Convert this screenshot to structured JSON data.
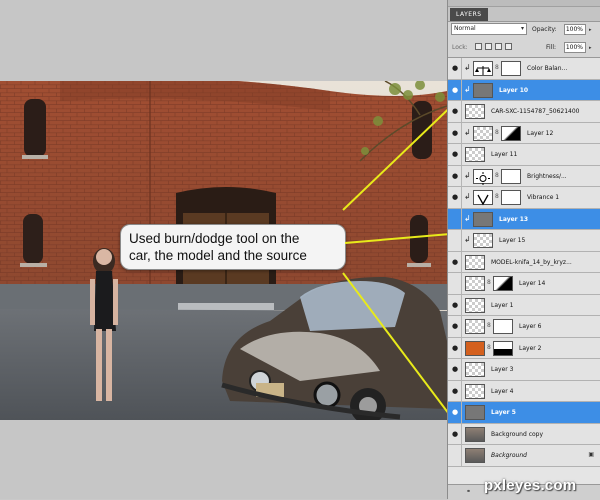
{
  "callout": {
    "line1": "Used burn/dodge tool on the",
    "line2": "car, the model and the source"
  },
  "panel": {
    "tab_label": "LAYERS",
    "blend_mode": "Normal",
    "opacity_label": "Opacity:",
    "opacity_value": "100%",
    "lock_label": "Lock:",
    "fill_label": "Fill:",
    "fill_value": "100%"
  },
  "layers": [
    {
      "name": "Color Balan...",
      "visible": true,
      "clipped": true,
      "selected": false,
      "thumb": "adjust-balance",
      "mask": true
    },
    {
      "name": "Layer 10",
      "visible": true,
      "clipped": true,
      "selected": true,
      "thumb": "gray",
      "mask": false
    },
    {
      "name": "CAR-SXC-1154787_50621400",
      "visible": true,
      "clipped": false,
      "selected": false,
      "thumb": "trans",
      "mask": false
    },
    {
      "name": "Layer 12",
      "visible": true,
      "clipped": true,
      "selected": false,
      "thumb": "trans",
      "mask": true
    },
    {
      "name": "Layer 11",
      "visible": true,
      "clipped": false,
      "selected": false,
      "thumb": "trans",
      "mask": false
    },
    {
      "name": "Brightness/...",
      "visible": true,
      "clipped": true,
      "selected": false,
      "thumb": "adjust-brightness",
      "mask": true
    },
    {
      "name": "Vibrance 1",
      "visible": true,
      "clipped": true,
      "selected": false,
      "thumb": "adjust-vibrance",
      "mask": true
    },
    {
      "name": "Layer 13",
      "visible": false,
      "clipped": true,
      "selected": true,
      "thumb": "gray",
      "mask": false
    },
    {
      "name": "Layer 15",
      "visible": false,
      "clipped": true,
      "selected": false,
      "thumb": "trans",
      "mask": false
    },
    {
      "name": "MODEL-knifa_14_by_kryz...",
      "visible": true,
      "clipped": false,
      "selected": false,
      "thumb": "trans",
      "mask": false
    },
    {
      "name": "Layer 14",
      "visible": false,
      "clipped": false,
      "selected": false,
      "thumb": "trans",
      "mask": true
    },
    {
      "name": "Layer 1",
      "visible": true,
      "clipped": false,
      "selected": false,
      "thumb": "trans",
      "mask": false
    },
    {
      "name": "Layer 6",
      "visible": true,
      "clipped": false,
      "selected": false,
      "thumb": "trans",
      "mask": true
    },
    {
      "name": "Layer 2",
      "visible": true,
      "clipped": false,
      "selected": false,
      "thumb": "orange",
      "mask": true
    },
    {
      "name": "Layer 3",
      "visible": true,
      "clipped": false,
      "selected": false,
      "thumb": "trans",
      "mask": false
    },
    {
      "name": "Layer 4",
      "visible": true,
      "clipped": false,
      "selected": false,
      "thumb": "trans",
      "mask": false
    },
    {
      "name": "Layer 5",
      "visible": true,
      "clipped": false,
      "selected": true,
      "thumb": "gray",
      "mask": false
    },
    {
      "name": "Background copy",
      "visible": true,
      "clipped": false,
      "selected": false,
      "thumb": "photo",
      "mask": false
    },
    {
      "name": "Background",
      "visible": false,
      "clipped": false,
      "selected": false,
      "thumb": "photo",
      "mask": false,
      "italic": true,
      "locked": true
    }
  ],
  "watermark": "pxleyes.com",
  "colors": {
    "selection": "#3d8ee6",
    "arrow": "#e8ea1a"
  }
}
